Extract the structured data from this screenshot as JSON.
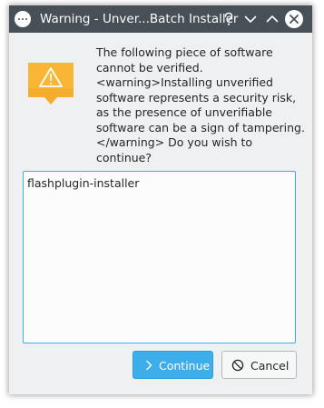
{
  "window": {
    "title": "Warning - Unver...Batch Installer",
    "menu_icon": "window-menu-icon",
    "buttons": {
      "help_icon": "help-icon",
      "minimize_icon": "minimize-icon",
      "maximize_icon": "maximize-icon",
      "close_icon": "close-icon"
    }
  },
  "dialog": {
    "icon": "warning-icon",
    "message": "The following piece of software cannot be verified. <warning>Installing unverified software represents a security risk, as the presence of unverifiable software can be a sign of tampering.</warning> Do you wish to continue?",
    "packages_text": "flashplugin-installer",
    "continue_label": "Continue",
    "continue_icon": "chevron-right-icon",
    "cancel_label": "Cancel",
    "cancel_icon": "cancel-icon"
  },
  "colors": {
    "titlebar": "#475057",
    "accent": "#3daee9",
    "warning": "#f8b634",
    "background": "#eff0f1"
  }
}
